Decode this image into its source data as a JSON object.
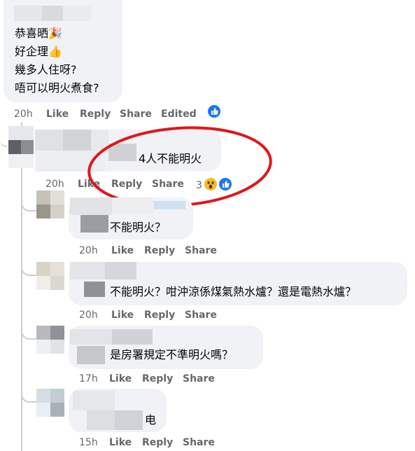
{
  "top_comment": {
    "lines": [
      "恭喜晒🎉",
      "好企理👍",
      "幾多人住呀?",
      "唔可以明火煮食?"
    ],
    "time": "20h",
    "like_label": "Like",
    "reply_label": "Reply",
    "share_label": "Share",
    "edited_label": "Edited"
  },
  "reply_1": {
    "text": "4人不能明火",
    "time": "20h",
    "like_label": "Like",
    "reply_label": "Reply",
    "share_label": "Share",
    "reaction_count": "3"
  },
  "reply_2": {
    "text": "不能明火？",
    "time": "20h",
    "like_label": "Like",
    "reply_label": "Reply",
    "share_label": "Share"
  },
  "reply_3": {
    "text": "不能明火？咁沖涼係煤氣熱水爐？還是電熱水爐？",
    "time": "20h",
    "like_label": "Like",
    "reply_label": "Reply",
    "share_label": "Share"
  },
  "reply_4": {
    "text": "是房署規定不準明火嗎？",
    "time": "17h",
    "like_label": "Like",
    "reply_label": "Reply",
    "share_label": "Share"
  },
  "reply_5": {
    "text": "电",
    "time": "15h",
    "like_label": "Like",
    "reply_label": "Reply",
    "share_label": "Share"
  },
  "colors": {
    "bubble": "#f0f2f5",
    "meta_text": "#65676b",
    "like_blue": "#1877f2",
    "annotation_red": "#e0161b"
  },
  "icons": [
    "like-reaction-icon",
    "wow-reaction-icon"
  ]
}
